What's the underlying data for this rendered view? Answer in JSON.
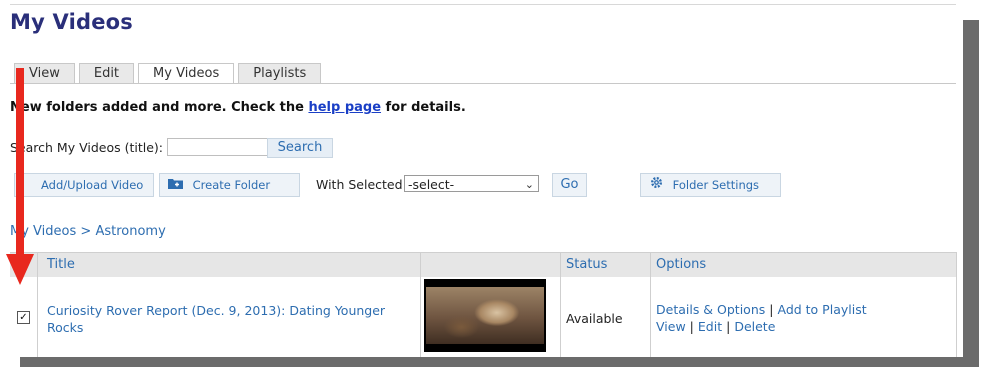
{
  "page": {
    "title": "My Videos"
  },
  "tabs": [
    {
      "label": "View"
    },
    {
      "label": "Edit"
    },
    {
      "label": "My Videos"
    },
    {
      "label": "Playlists"
    }
  ],
  "notice": {
    "prefix": "New folders added and more. Check the",
    "link": "help page",
    "suffix": "for details."
  },
  "search": {
    "label": "Search My Videos (title):",
    "value": "",
    "button": "Search"
  },
  "actions": {
    "add_upload": "Add/Upload Video",
    "create_folder": "Create Folder",
    "with_selected_label": "With Selected",
    "select_value": "-select-",
    "go": "Go",
    "folder_settings": "Folder Settings"
  },
  "breadcrumb": {
    "root": "My Videos",
    "separator": ">",
    "current": "Astronomy"
  },
  "table": {
    "headers": {
      "title": "Title",
      "status": "Status",
      "options": "Options"
    },
    "rows": [
      {
        "checked": true,
        "title": "Curiosity Rover Report (Dec. 9, 2013): Dating Younger Rocks",
        "status": "Available",
        "options": {
          "details": "Details & Options",
          "add_playlist": "Add to Playlist",
          "view": "View",
          "edit": "Edit",
          "delete": "Delete",
          "separator": "|"
        }
      }
    ]
  },
  "colors": {
    "title": "#2a2f7a",
    "link": "#2d6db0",
    "annotation_arrow": "#e8281e"
  }
}
